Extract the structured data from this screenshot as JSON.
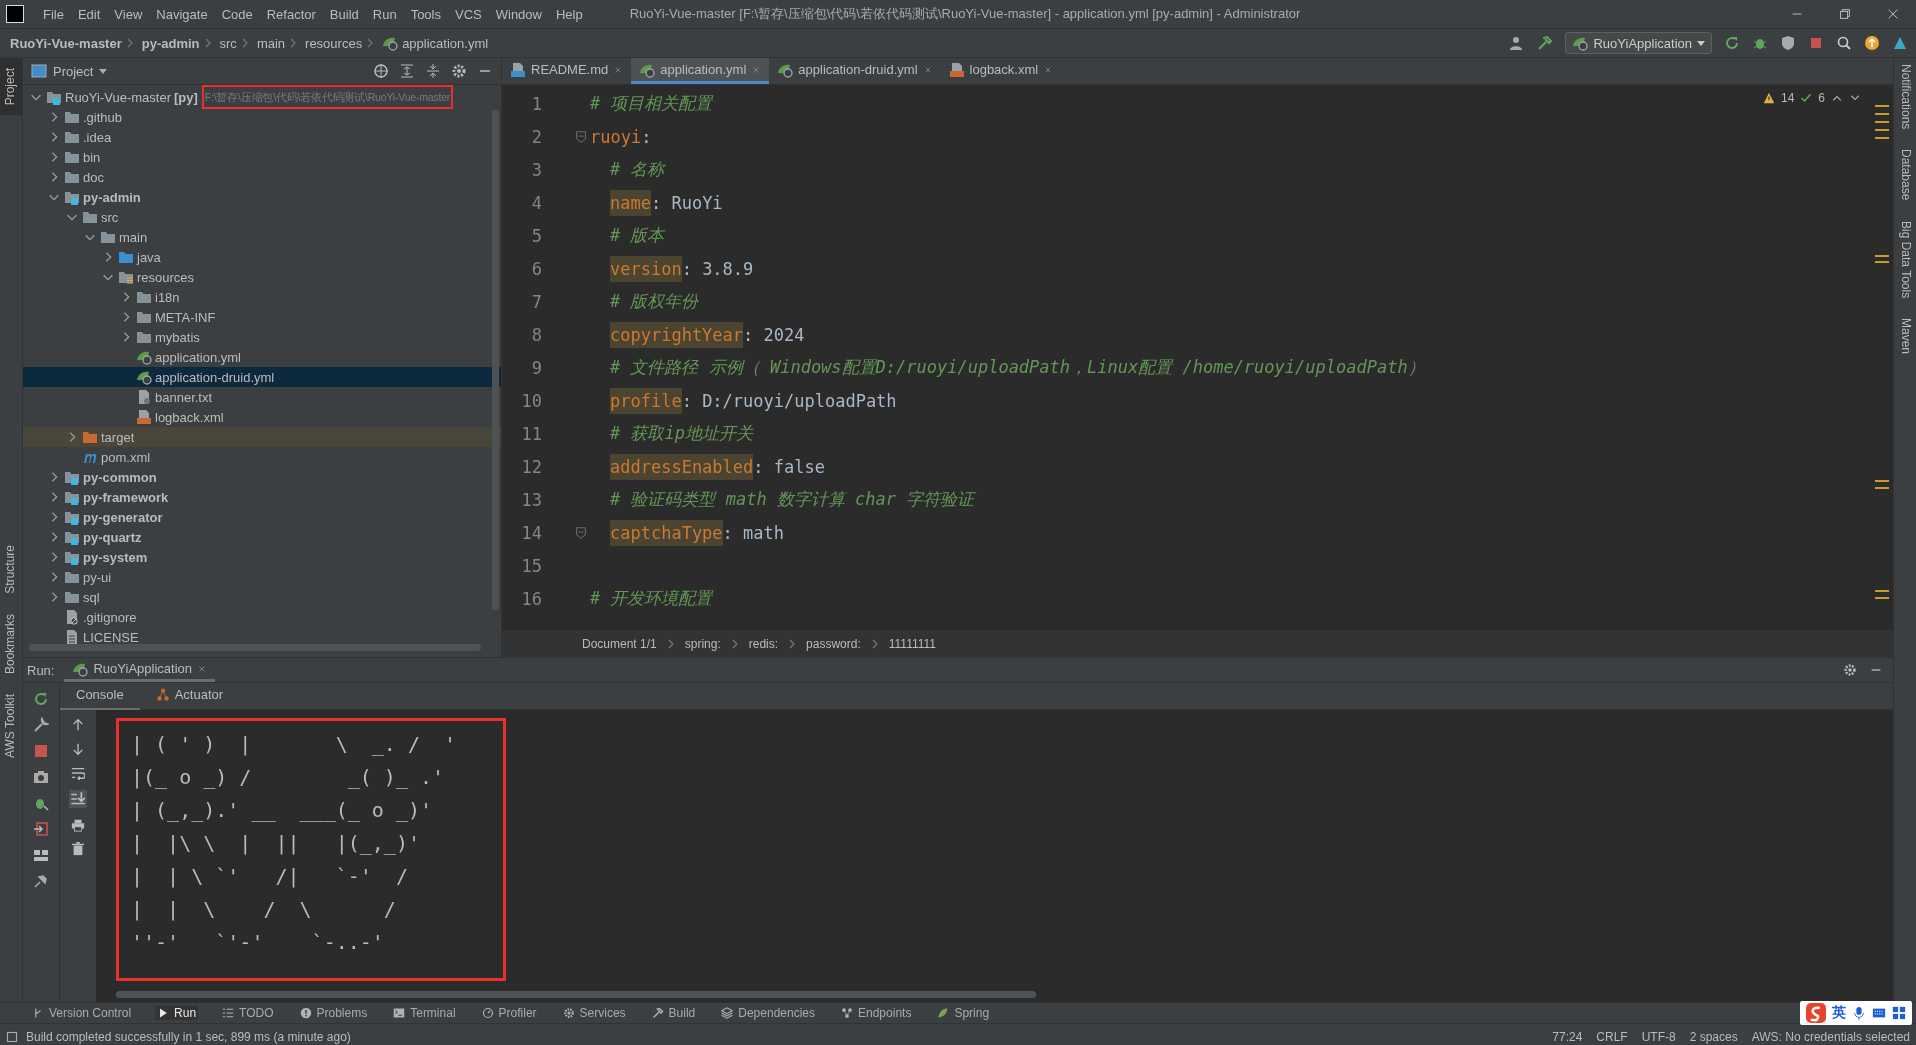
{
  "menu": [
    "File",
    "Edit",
    "View",
    "Navigate",
    "Code",
    "Refactor",
    "Build",
    "Run",
    "Tools",
    "VCS",
    "Window",
    "Help"
  ],
  "window": {
    "title": "RuoYi-Vue-master [F:\\暂存\\压缩包\\代码\\若依代码测试\\RuoYi-Vue-master] - application.yml [py-admin] - Administrator"
  },
  "breadcrumbs": [
    {
      "label": "RuoYi-Vue-master",
      "bold": true
    },
    {
      "label": "py-admin",
      "bold": true
    },
    {
      "label": "src",
      "bold": false
    },
    {
      "label": "main",
      "bold": false
    },
    {
      "label": "resources",
      "bold": false
    },
    {
      "label": "application.yml",
      "bold": false
    }
  ],
  "run_config": "RuoYiApplication",
  "left_stripe": [
    {
      "label": "Project",
      "selected": true
    },
    {
      "label": "Structure",
      "selected": false
    },
    {
      "label": "Bookmarks",
      "selected": false
    },
    {
      "label": "AWS Toolkit",
      "selected": false
    }
  ],
  "right_stripe": [
    "Notifications",
    "Database",
    "Big Data Tools",
    "Maven"
  ],
  "project": {
    "title": "Project",
    "tree": [
      {
        "name": "RuoYi-Vue-master",
        "suffix": "[py]",
        "path": "F:\\暂存\\压缩包\\代码\\若依代码测试\\RuoYi-Vue-master",
        "kind": "module",
        "bold": false,
        "expanded": true,
        "selected": false,
        "children": [
          {
            "name": ".github",
            "kind": "folder",
            "bold": false,
            "expanded": false,
            "selected": false
          },
          {
            "name": ".idea",
            "kind": "folder",
            "bold": false,
            "expanded": false,
            "selected": false
          },
          {
            "name": "bin",
            "kind": "folder",
            "bold": false,
            "expanded": false,
            "selected": false
          },
          {
            "name": "doc",
            "kind": "folder",
            "bold": false,
            "expanded": false,
            "selected": false
          },
          {
            "name": "py-admin",
            "kind": "module",
            "bold": true,
            "expanded": true,
            "selected": false,
            "children": [
              {
                "name": "src",
                "kind": "folder",
                "bold": false,
                "expanded": true,
                "selected": false,
                "children": [
                  {
                    "name": "main",
                    "kind": "folder",
                    "bold": false,
                    "expanded": true,
                    "selected": false,
                    "children": [
                      {
                        "name": "java",
                        "kind": "source",
                        "bold": false,
                        "expanded": false,
                        "selected": false
                      },
                      {
                        "name": "resources",
                        "kind": "resources",
                        "bold": false,
                        "expanded": true,
                        "selected": false,
                        "children": [
                          {
                            "name": "i18n",
                            "kind": "folder",
                            "bold": false,
                            "expanded": false,
                            "selected": false
                          },
                          {
                            "name": "META-INF",
                            "kind": "folder",
                            "bold": false,
                            "expanded": false,
                            "selected": false
                          },
                          {
                            "name": "mybatis",
                            "kind": "folder",
                            "bold": false,
                            "expanded": false,
                            "selected": false
                          },
                          {
                            "name": "application.yml",
                            "kind": "yaml",
                            "bold": false,
                            "selected": false
                          },
                          {
                            "name": "application-druid.yml",
                            "kind": "yaml",
                            "bold": false,
                            "selected": true
                          },
                          {
                            "name": "banner.txt",
                            "kind": "text",
                            "bold": false,
                            "selected": false
                          },
                          {
                            "name": "logback.xml",
                            "kind": "xml",
                            "bold": false,
                            "selected": false
                          }
                        ]
                      }
                    ]
                  }
                ]
              },
              {
                "name": "target",
                "kind": "excluded",
                "bold": false,
                "expanded": false,
                "selected": false
              },
              {
                "name": "pom.xml",
                "kind": "maven",
                "bold": false,
                "selected": false
              }
            ]
          },
          {
            "name": "py-common",
            "kind": "module",
            "bold": true,
            "expanded": false,
            "selected": false
          },
          {
            "name": "py-framework",
            "kind": "module",
            "bold": true,
            "expanded": false,
            "selected": false
          },
          {
            "name": "py-generator",
            "kind": "module",
            "bold": true,
            "expanded": false,
            "selected": false
          },
          {
            "name": "py-quartz",
            "kind": "module",
            "bold": true,
            "expanded": false,
            "selected": false
          },
          {
            "name": "py-system",
            "kind": "module",
            "bold": true,
            "expanded": false,
            "selected": false
          },
          {
            "name": "py-ui",
            "kind": "folder",
            "bold": false,
            "expanded": false,
            "selected": false
          },
          {
            "name": "sql",
            "kind": "folder",
            "bold": false,
            "expanded": false,
            "selected": false
          },
          {
            "name": ".gitignore",
            "kind": "ignore",
            "bold": false,
            "selected": false
          },
          {
            "name": "LICENSE",
            "kind": "license",
            "bold": false,
            "selected": false
          }
        ]
      }
    ]
  },
  "editor_tabs": [
    {
      "label": "README.md",
      "kind": "markdown",
      "selected": false
    },
    {
      "label": "application.yml",
      "kind": "yaml",
      "selected": true
    },
    {
      "label": "application-druid.yml",
      "kind": "yaml",
      "selected": false
    },
    {
      "label": "logback.xml",
      "kind": "xml",
      "selected": false
    }
  ],
  "inspections": {
    "warnings": "14",
    "ok": "6"
  },
  "lines": [
    {
      "number": "1",
      "kind": "comment",
      "nested": false,
      "fold": false,
      "text": "# 项目相关配置"
    },
    {
      "number": "2",
      "kind": "section",
      "nested": false,
      "fold": true,
      "key": "ruoyi",
      "rest": ":"
    },
    {
      "number": "3",
      "kind": "comment",
      "nested": true,
      "fold": false,
      "text": "# 名称"
    },
    {
      "number": "4",
      "kind": "key",
      "nested": true,
      "fold": false,
      "key": "name",
      "rest": ": RuoYi"
    },
    {
      "number": "5",
      "kind": "comment",
      "nested": true,
      "fold": false,
      "text": "# 版本"
    },
    {
      "number": "6",
      "kind": "key",
      "nested": true,
      "fold": false,
      "key": "version",
      "rest": ": 3.8.9"
    },
    {
      "number": "7",
      "kind": "comment",
      "nested": true,
      "fold": false,
      "text": "# 版权年份"
    },
    {
      "number": "8",
      "kind": "key",
      "nested": true,
      "fold": false,
      "key": "copyrightYear",
      "rest": ": 2024"
    },
    {
      "number": "9",
      "kind": "comment",
      "nested": true,
      "fold": false,
      "text": "# 文件路径 示例（ Windows配置D:/ruoyi/uploadPath，Linux配置 /home/ruoyi/uploadPath）"
    },
    {
      "number": "10",
      "kind": "key",
      "nested": true,
      "fold": false,
      "key": "profile",
      "rest": ": D:/ruoyi/uploadPath"
    },
    {
      "number": "11",
      "kind": "comment",
      "nested": true,
      "fold": false,
      "text": "# 获取ip地址开关"
    },
    {
      "number": "12",
      "kind": "key",
      "nested": true,
      "fold": false,
      "key": "addressEnabled",
      "rest": ": false"
    },
    {
      "number": "13",
      "kind": "comment",
      "nested": true,
      "fold": false,
      "text": "# 验证码类型 math 数字计算 char 字符验证"
    },
    {
      "number": "14",
      "kind": "key",
      "nested": true,
      "fold": true,
      "key": "captchaType",
      "rest": ": math"
    },
    {
      "number": "15",
      "kind": "blank",
      "fold": false
    },
    {
      "number": "16",
      "kind": "comment",
      "nested": false,
      "fold": false,
      "text": "# 开发环境配置"
    }
  ],
  "editor_breadcrumbs": [
    "Document 1/1",
    "spring:",
    "redis:",
    "password:",
    "11111111"
  ],
  "run": {
    "label": "Run:",
    "tab": "RuoYiApplication",
    "subtabs": [
      {
        "label": "Console",
        "selected": true
      },
      {
        "label": "Actuator",
        "selected": false
      }
    ],
    "console": [
      "| ( ' )  |       \\  _. /  '",
      "|(_ o _) /        _( )_ .'",
      "| (_,_).' __  ___(_ o _)'",
      "|  |\\ \\  |  ||   |(_,_)'",
      "|  | \\ `'   /|   `-'  /",
      "|  |  \\    /  \\      /",
      "''-'   `'-'    `-..-'"
    ]
  },
  "tool_windows": [
    {
      "label": "Version Control",
      "kind": "branch",
      "selected": false
    },
    {
      "label": "Run",
      "kind": "play",
      "selected": true
    },
    {
      "label": "TODO",
      "kind": "list",
      "selected": false
    },
    {
      "label": "Problems",
      "kind": "info",
      "selected": false
    },
    {
      "label": "Terminal",
      "kind": "terminal",
      "selected": false
    },
    {
      "label": "Profiler",
      "kind": "gauge",
      "selected": false
    },
    {
      "label": "Services",
      "kind": "gear",
      "selected": false
    },
    {
      "label": "Build",
      "kind": "hammer",
      "selected": false
    },
    {
      "label": "Dependencies",
      "kind": "stack",
      "selected": false
    },
    {
      "label": "Endpoints",
      "kind": "nodes",
      "selected": false
    },
    {
      "label": "Spring",
      "kind": "leaf",
      "selected": false
    }
  ],
  "status_bar": {
    "message": "Build completed successfully in 1 sec, 899 ms (a minute ago)",
    "items": [
      "77:24",
      "CRLF",
      "UTF-8",
      "2 spaces",
      "AWS: No credentials selected"
    ]
  },
  "ime_toolbar": {
    "mode": "英"
  }
}
